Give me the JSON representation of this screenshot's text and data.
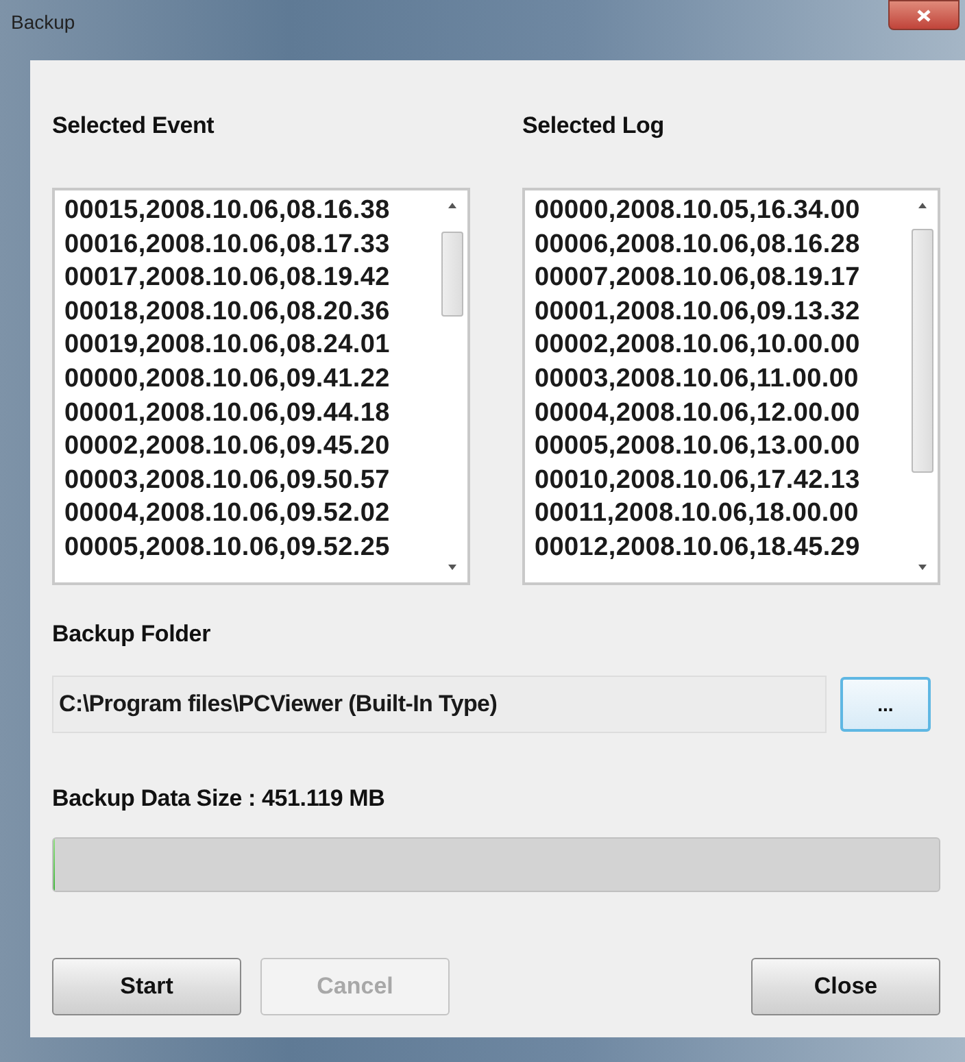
{
  "window": {
    "title": "Backup"
  },
  "lists": [
    {
      "label": "Selected Event",
      "items": [
        "00015,2008.10.06,08.16.38",
        "00016,2008.10.06,08.17.33",
        "00017,2008.10.06,08.19.42",
        "00018,2008.10.06,08.20.36",
        "00019,2008.10.06,08.24.01",
        "00000,2008.10.06,09.41.22",
        "00001,2008.10.06,09.44.18",
        "00002,2008.10.06,09.45.20",
        "00003,2008.10.06,09.50.57",
        "00004,2008.10.06,09.52.02",
        "00005,2008.10.06,09.52.25"
      ]
    },
    {
      "label": "Selected Log",
      "items": [
        "00000,2008.10.05,16.34.00",
        "00006,2008.10.06,08.16.28",
        "00007,2008.10.06,08.19.17",
        "00001,2008.10.06,09.13.32",
        "00002,2008.10.06,10.00.00",
        "00003,2008.10.06,11.00.00",
        "00004,2008.10.06,12.00.00",
        "00005,2008.10.06,13.00.00",
        "00010,2008.10.06,17.42.13",
        "00011,2008.10.06,18.00.00",
        "00012,2008.10.06,18.45.29"
      ]
    }
  ],
  "folder": {
    "label": "Backup Folder",
    "value": "C:\\Program files\\PCViewer (Built-In Type)",
    "browse": "..."
  },
  "size_label": "Backup Data Size : 451.119 MB",
  "progress": {
    "level": 0
  },
  "buttons": [
    {
      "label": "Start",
      "disabled": false
    },
    {
      "label": "Cancel",
      "disabled": true
    },
    {
      "label": "Close",
      "disabled": false
    }
  ]
}
